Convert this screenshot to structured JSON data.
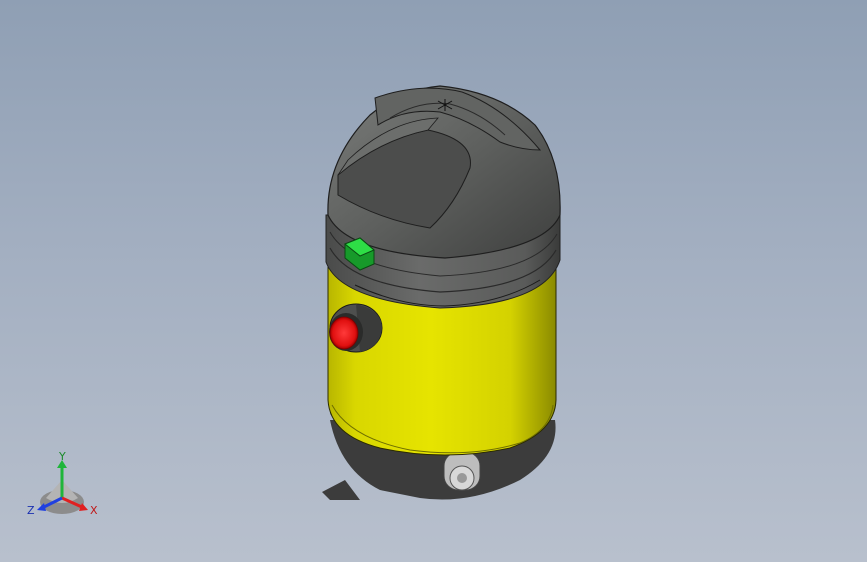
{
  "model": {
    "name": "",
    "colors": {
      "body": "#e2e000",
      "body_shade": "#8a8a00",
      "lid": "#5a5c5a",
      "lid_dark": "#3a3b3a",
      "switch": "#22c43a",
      "inlet_ring": "#505050",
      "inlet_core": "#e81010",
      "shadow": "#3c3c3c",
      "background_top": "#8f9fb4",
      "background_bottom": "#b8c0cd"
    }
  },
  "triad": {
    "x_label": "X",
    "y_label": "Y",
    "z_label": "Z",
    "colors": {
      "x": "#e02020",
      "y": "#1fb53a",
      "z": "#2040e0"
    }
  }
}
